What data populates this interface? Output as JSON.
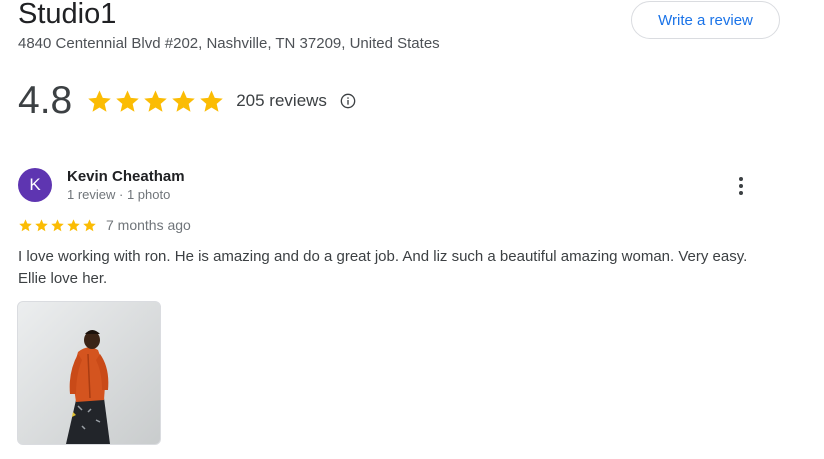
{
  "business": {
    "name": "Studio1",
    "address": "4840 Centennial Blvd #202, Nashville, TN 37209, United States",
    "write_review_label": "Write a review"
  },
  "rating": {
    "value": "4.8",
    "stars_filled": 5,
    "review_count_label": "205 reviews",
    "star_color": "#fbbc04"
  },
  "review": {
    "avatar_initial": "K",
    "avatar_color": "#5e35b1",
    "reviewer_name": "Kevin Cheatham",
    "reviewer_meta": "1 review · 1 photo",
    "stars": 5,
    "date": "7 months ago",
    "text": "I love working with ron. He is amazing and do a great job. And liz such a beautiful amazing woman. Very easy. Ellie love her.",
    "photo_icon": "review-photo"
  },
  "colors": {
    "link_blue": "#1a73e8",
    "muted_text": "#70757a"
  }
}
